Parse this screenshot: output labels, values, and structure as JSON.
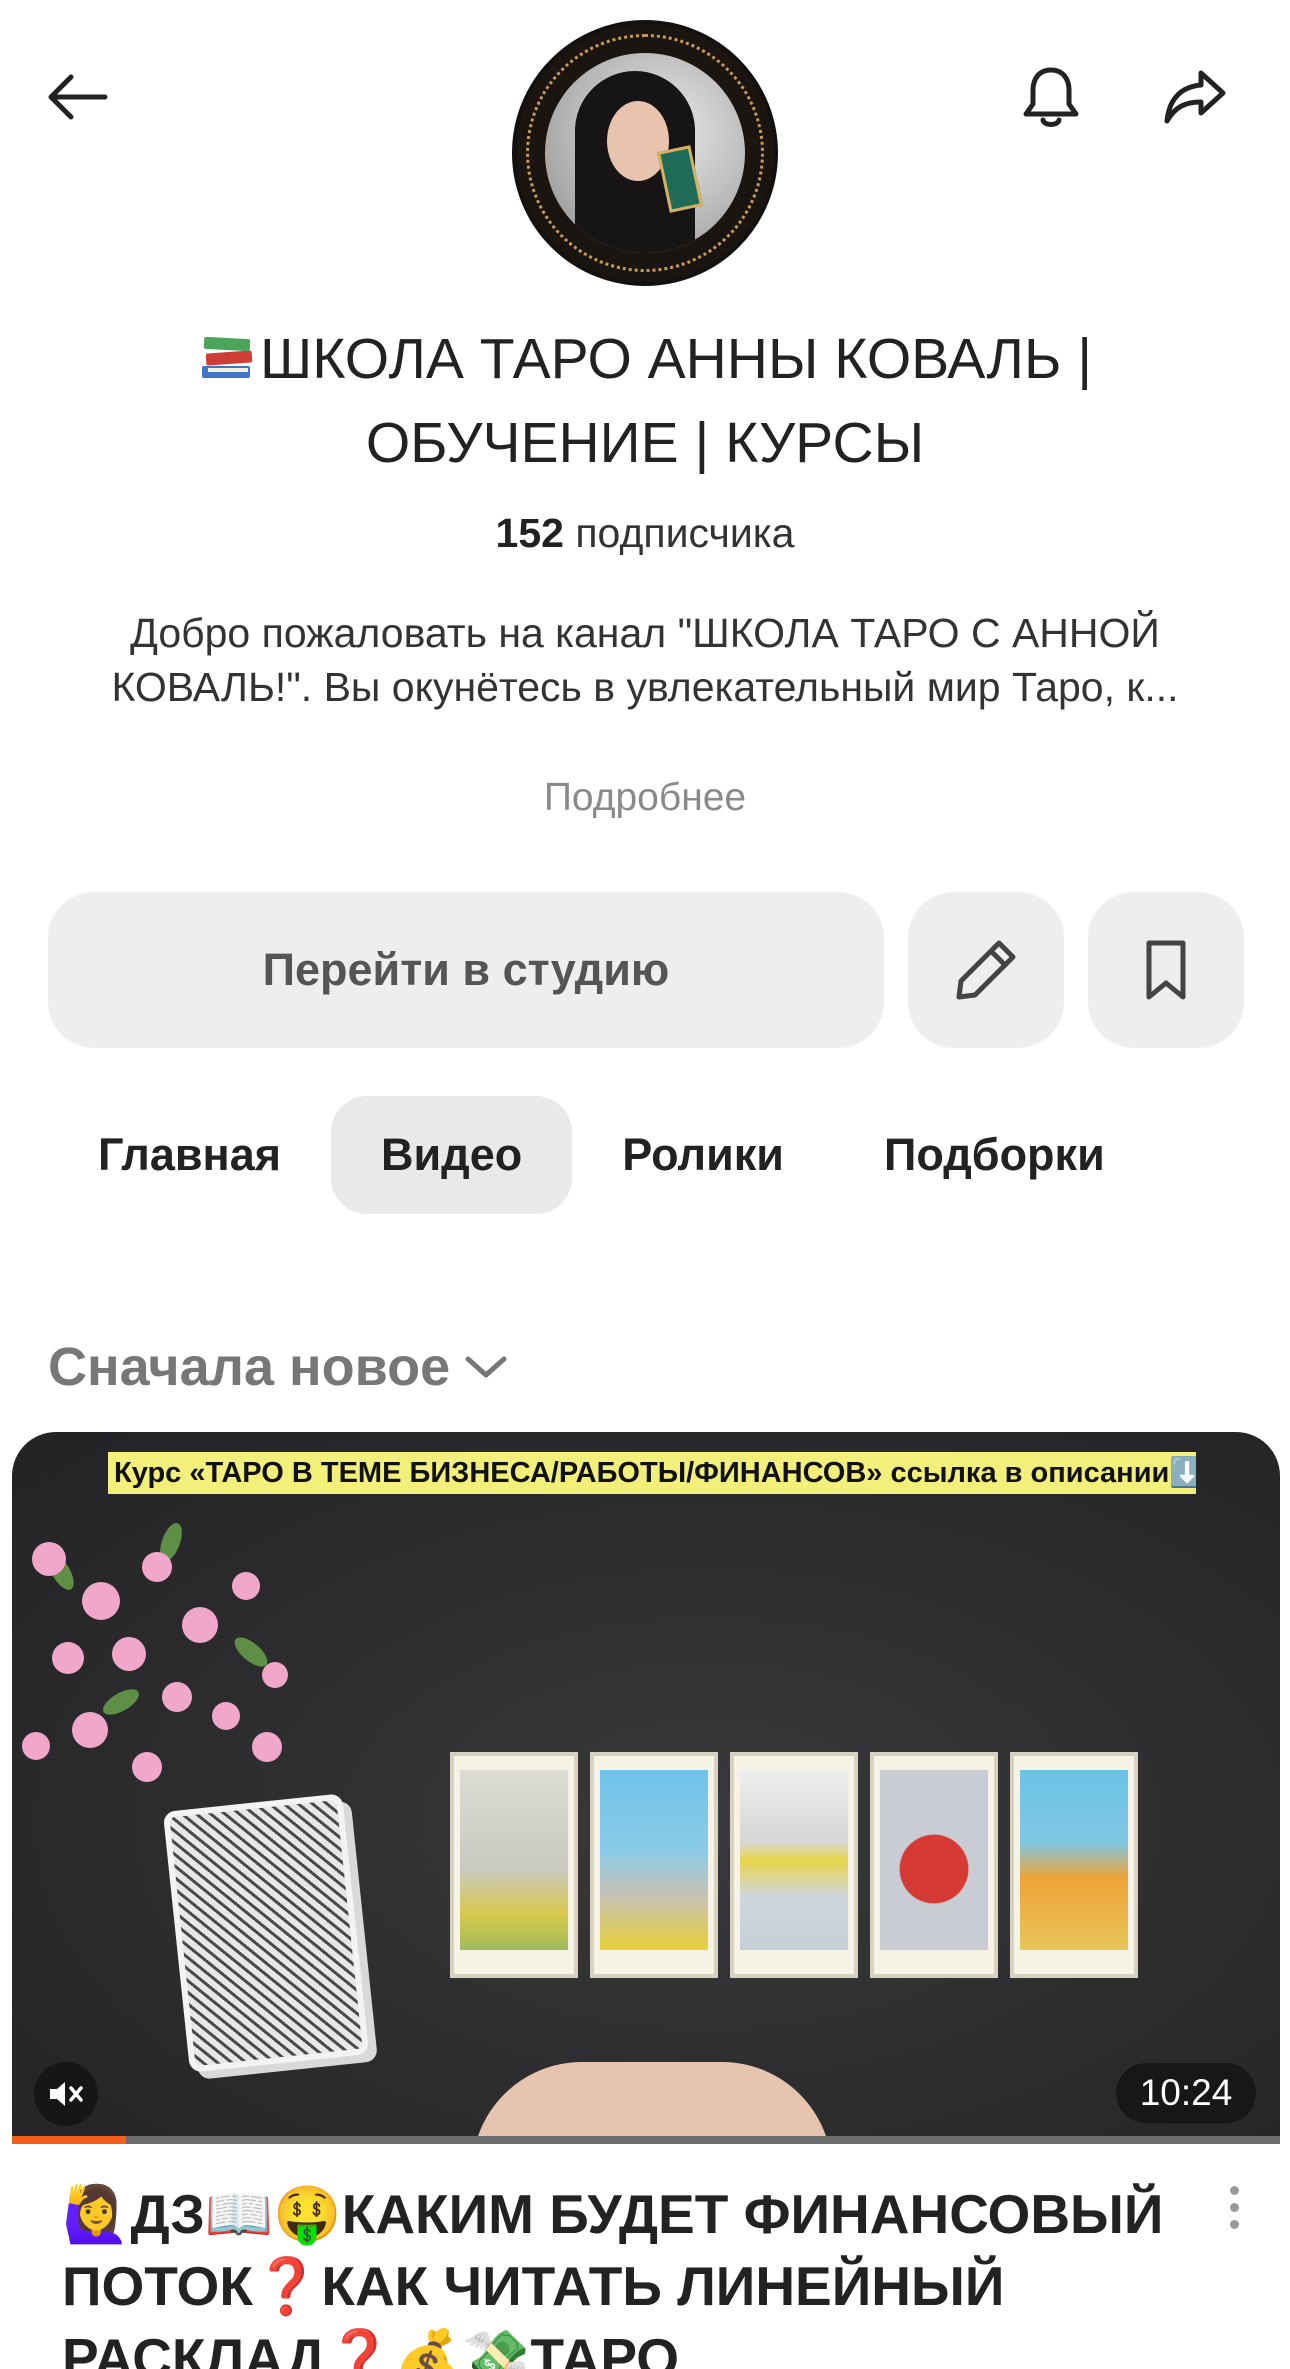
{
  "header": {
    "back_icon": "arrow-left-icon",
    "bell_icon": "bell-icon",
    "share_icon": "share-icon"
  },
  "channel": {
    "title": "ШКОЛА ТАРО АННЫ КОВАЛЬ | ОБУЧЕНИЕ | КУРСЫ",
    "title_emoji": "📚",
    "subscribers_count": "152",
    "subscribers_label": " подписчика",
    "description": "Добро пожаловать на канал \"ШКОЛА ТАРО С АННОЙ КОВАЛЬ!\". Вы окунётесь в увлекательный мир Таро, к...",
    "more_label": "Подробнее"
  },
  "actions": {
    "studio_label": "Перейти в студию",
    "edit_icon": "pencil-icon",
    "bookmark_icon": "bookmark-icon"
  },
  "tabs": [
    {
      "label": "Главная",
      "active": false
    },
    {
      "label": "Видео",
      "active": true
    },
    {
      "label": "Ролики",
      "active": false
    },
    {
      "label": "Подборки",
      "active": false
    }
  ],
  "sort": {
    "label": "Сначала новое",
    "icon": "chevron-down-icon"
  },
  "video": {
    "thumbnail_banner": "Курс «ТАРО В ТЕМЕ БИЗНЕСА/РАБОТЫ/ФИНАНСОВ» ссылка в описании⬇️",
    "duration": "10:24",
    "progress_fraction": 0.09,
    "title": "🙋‍♀️ДЗ📖🤑КАКИМ БУДЕТ ФИНАНСОВЫЙ ПОТОК❓КАК ЧИТАТЬ ЛИНЕЙНЫЙ РАСКЛАД❓💰💸ТАРО",
    "mute_icon": "muted-speaker-icon",
    "menu_icon": "more-vertical-icon"
  },
  "colors": {
    "accent_progress": "#f35e1d",
    "button_bg": "#eeeeef",
    "muted_text": "#8a8a8a"
  }
}
